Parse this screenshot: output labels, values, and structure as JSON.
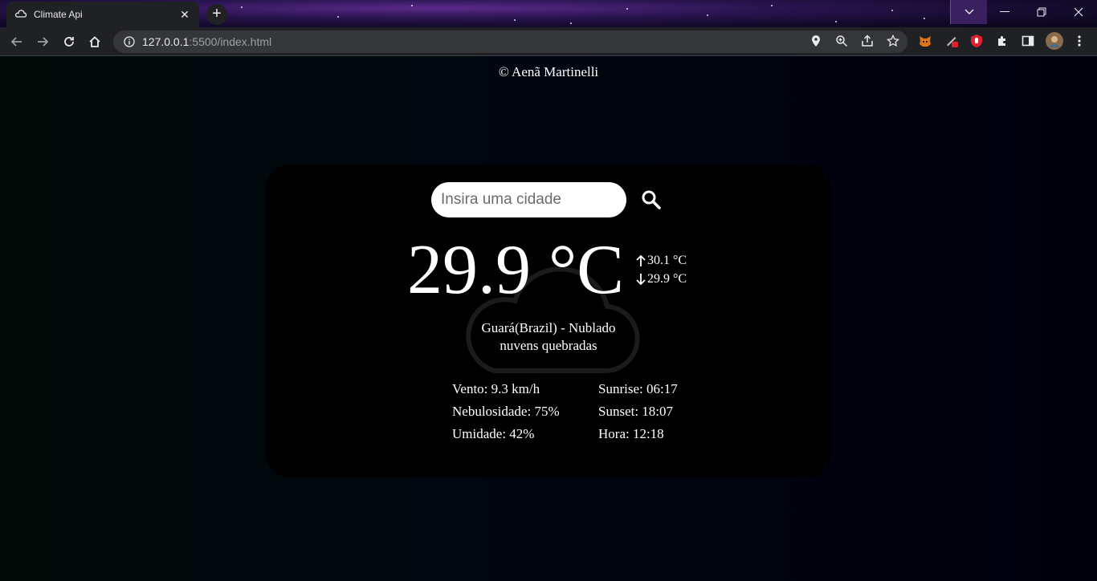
{
  "browser": {
    "tab_title": "Climate Api",
    "url_host": "127.0.0.1",
    "url_rest": ":5500/index.html"
  },
  "page": {
    "copyright": "© Aenã Martinelli"
  },
  "weather": {
    "search_placeholder": "Insira uma cidade",
    "temperature": "29.9 °C",
    "temp_max": "30.1 °C",
    "temp_min": "29.9 °C",
    "location_line": "Guará(Brazil) - Nublado",
    "description": "nuvens quebradas",
    "wind": "Vento: 9.3 km/h",
    "cloudiness": "Nebulosidade: 75%",
    "humidity": "Umidade: 42%",
    "sunrise": "Sunrise: 06:17",
    "sunset": "Sunset: 18:07",
    "time": "Hora: 12:18"
  },
  "colors": {
    "card_bg": "#000000",
    "text": "#ffffff",
    "input_bg": "#ffffff"
  }
}
